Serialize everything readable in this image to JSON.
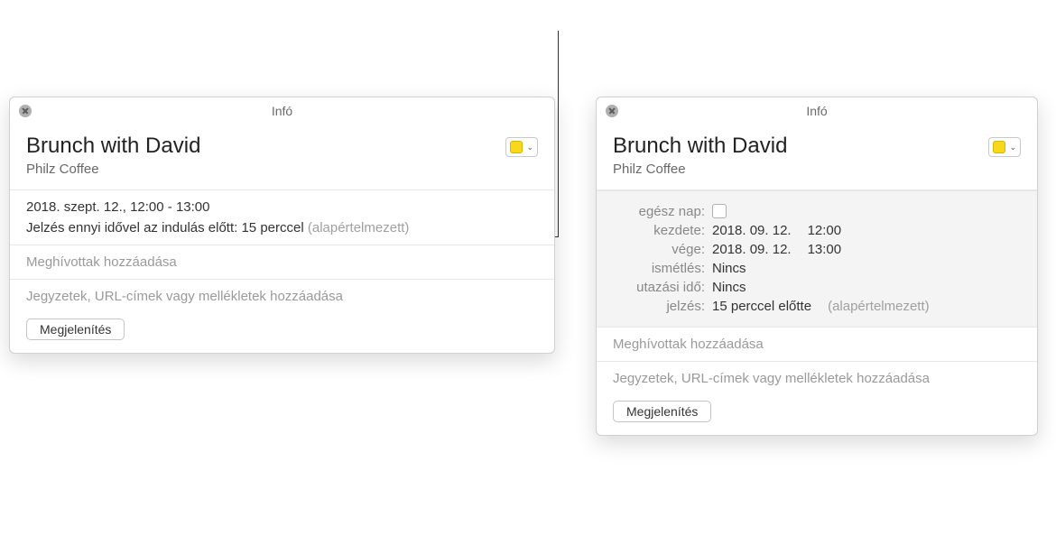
{
  "left": {
    "titlebar": "Infó",
    "title": "Brunch with David",
    "location": "Philz Coffee",
    "time_range": "2018. szept. 12., 12:00 - 13:00",
    "alert_text": "Jelzés ennyi idővel az indulás előtt: 15 perccel",
    "alert_default": "(alapértelmezett)",
    "invitees_placeholder": "Meghívottak hozzáadása",
    "notes_placeholder": "Jegyzetek, URL-címek vagy mellékletek hozzáadása",
    "show_button": "Megjelenítés"
  },
  "right": {
    "titlebar": "Infó",
    "title": "Brunch with David",
    "location": "Philz Coffee",
    "labels": {
      "all_day": "egész nap:",
      "starts": "kezdete:",
      "ends": "vége:",
      "repeat": "ismétlés:",
      "travel": "utazási idő:",
      "alert": "jelzés:"
    },
    "values": {
      "start_date": "2018. 09. 12.",
      "start_time": "12:00",
      "end_date": "2018. 09. 12.",
      "end_time": "13:00",
      "repeat": "Nincs",
      "travel": "Nincs",
      "alert": "15 perccel előtte",
      "alert_default": "(alapértelmezett)"
    },
    "invitees_placeholder": "Meghívottak hozzáadása",
    "notes_placeholder": "Jegyzetek, URL-címek vagy mellékletek hozzáadása",
    "show_button": "Megjelenítés"
  }
}
